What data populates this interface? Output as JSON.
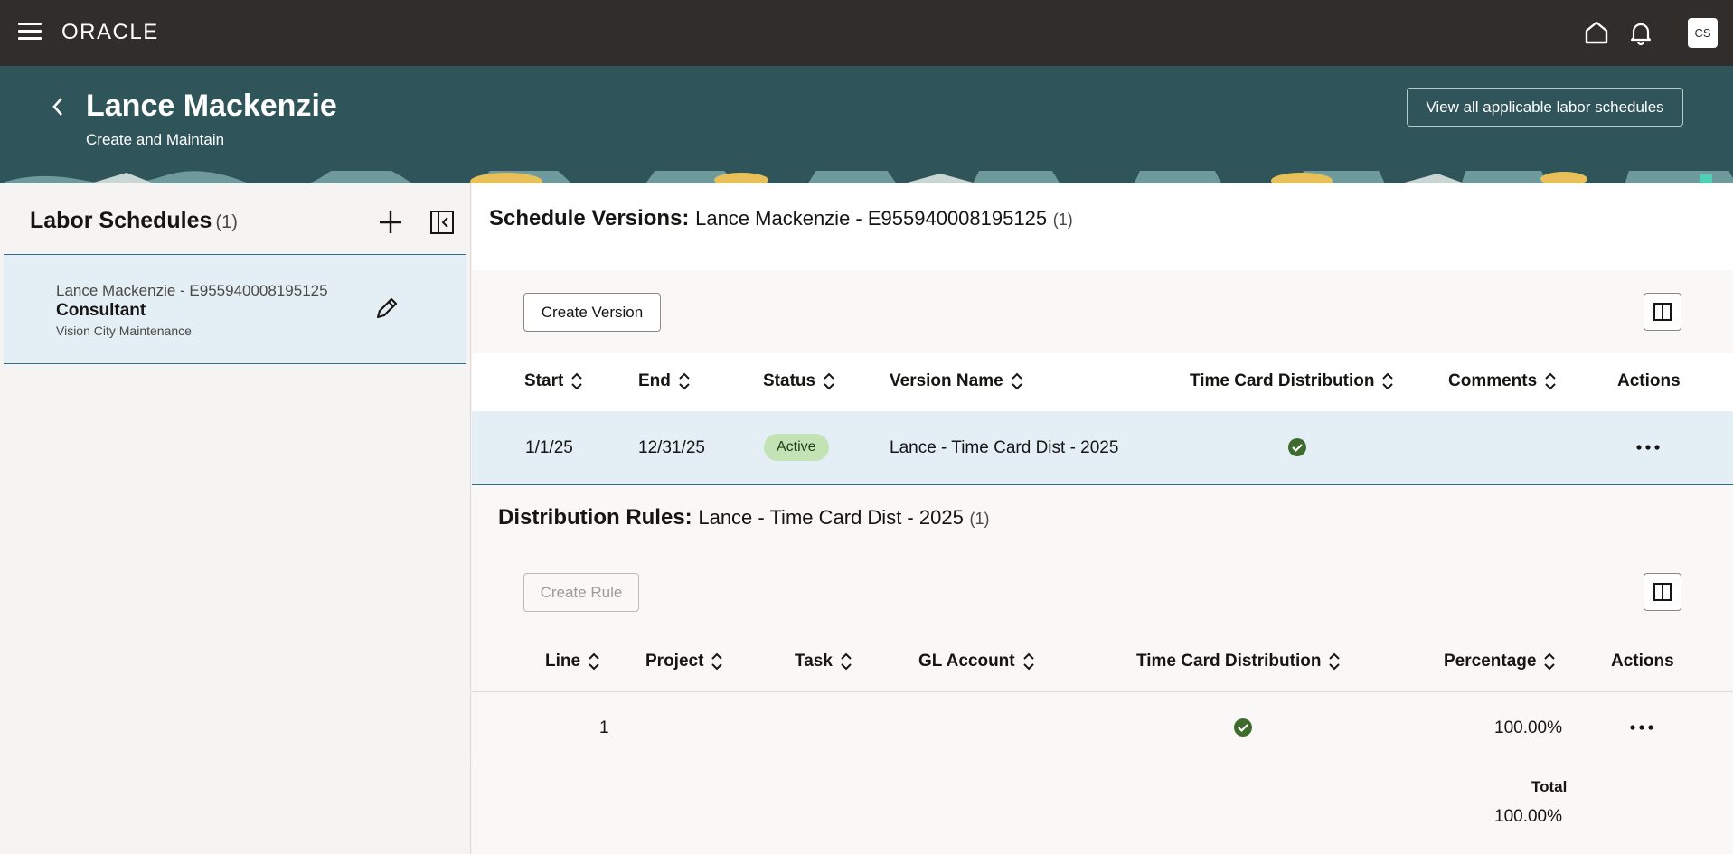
{
  "topbar": {
    "logo": "ORACLE",
    "avatar_initials": "CS",
    "icons": [
      "menu-icon",
      "home-icon",
      "bell-icon"
    ]
  },
  "header": {
    "title": "Lance Mackenzie",
    "subtitle": "Create and Maintain",
    "view_all_label": "View all applicable labor schedules"
  },
  "labor_schedules": {
    "title": "Labor Schedules",
    "count": "(1)",
    "items": [
      {
        "name": "Lance Mackenzie - E955940008195125",
        "role": "Consultant",
        "org": "Vision City Maintenance"
      }
    ]
  },
  "schedule_versions": {
    "title": "Schedule Versions:",
    "value": "Lance Mackenzie - E955940008195125",
    "count": "(1)",
    "create_label": "Create Version",
    "columns": [
      "Start",
      "End",
      "Status",
      "Version Name",
      "Time Card Distribution",
      "Comments",
      "Actions"
    ],
    "rows": [
      {
        "start": "1/1/25",
        "end": "12/31/25",
        "status": "Active",
        "version_name": "Lance - Time Card Dist - 2025",
        "time_card_distribution": true,
        "comments": ""
      }
    ]
  },
  "distribution_rules": {
    "title": "Distribution Rules:",
    "value": "Lance - Time Card Dist - 2025",
    "count": "(1)",
    "create_label": "Create Rule",
    "columns": [
      "Line",
      "Project",
      "Task",
      "GL Account",
      "Time Card Distribution",
      "Percentage",
      "Actions"
    ],
    "rows": [
      {
        "line": "1",
        "project": "",
        "task": "",
        "gl_account": "",
        "time_card_distribution": true,
        "percentage": "100.00%"
      }
    ],
    "total_label": "Total",
    "total_value": "100.00%"
  },
  "colors": {
    "topbar": "#312d2a",
    "header": "#2f545a",
    "selected_row": "#e4eff5",
    "active_badge": "#c4e3b5",
    "check": "#3f6b2e"
  }
}
